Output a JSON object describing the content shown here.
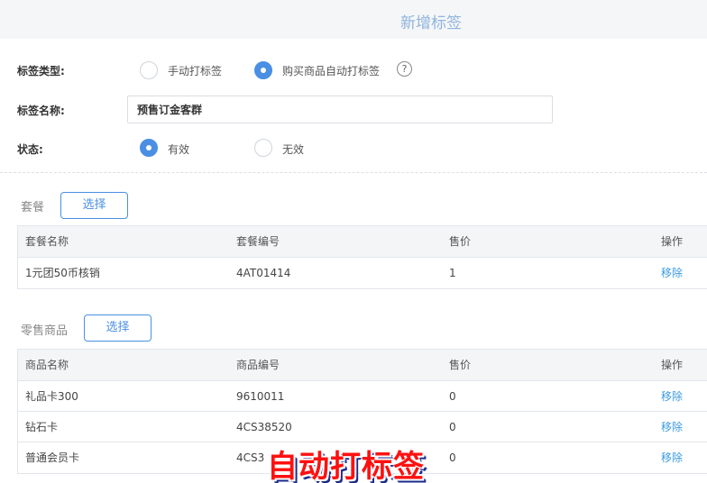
{
  "header": {
    "title": "新增标签"
  },
  "form": {
    "tag_type_label": "标签类型:",
    "tag_type_options": [
      "手动打标签",
      "购买商品自动打标签"
    ],
    "tag_type_selected": "购买商品自动打标签",
    "tag_name_label": "标签名称:",
    "tag_name_value": "预售订金客群",
    "status_label": "状态:",
    "status_options": [
      "有效",
      "无效"
    ],
    "status_selected": "有效"
  },
  "package_section": {
    "title": "套餐",
    "select_label": "选择",
    "columns": [
      "套餐名称",
      "套餐编号",
      "售价",
      "操作"
    ],
    "rows": [
      {
        "name": "1元团50币核销",
        "code": "4AT01414",
        "price": "1",
        "action": "移除"
      }
    ]
  },
  "retail_section": {
    "title": "零售商品",
    "select_label": "选择",
    "columns": [
      "商品名称",
      "商品编号",
      "售价",
      "操作"
    ],
    "rows": [
      {
        "name": "礼品卡300",
        "code": "9610011",
        "price": "0",
        "action": "移除"
      },
      {
        "name": "钻石卡",
        "code": "4CS38520",
        "price": "0",
        "action": "移除"
      },
      {
        "name": "普通会员卡",
        "code": "4CS3",
        "price": "0",
        "action": "移除"
      }
    ]
  },
  "overlay_caption": "自动打标签",
  "colors": {
    "accent": "#4a8fe3",
    "link": "#3a9ae0",
    "caption": "#ff1010"
  }
}
